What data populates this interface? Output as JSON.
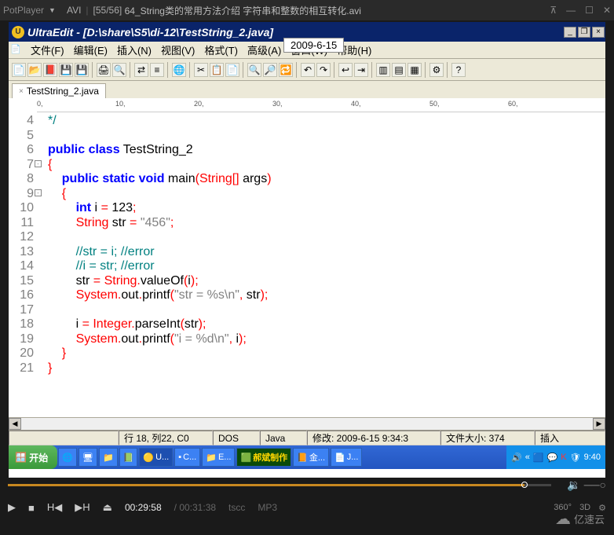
{
  "player": {
    "app_name": "PotPlayer",
    "format": "AVI",
    "counter": "[55/56]",
    "filename": "64_String类的常用方法介绍 字符串和整数的相互转化.avi",
    "time_current": "00:29:58",
    "time_total": "00:31:38",
    "codec_v": "tscc",
    "codec_a": "MP3",
    "opt_360": "360°",
    "opt_3d": "3D",
    "date_overlay": "2009-6-15"
  },
  "ultraedit": {
    "title": "UltraEdit - [D:\\share\\S5\\di-12\\TestString_2.java]",
    "menus": {
      "file": "文件(F)",
      "edit": "编辑(E)",
      "insert": "插入(N)",
      "view": "视图(V)",
      "format": "格式(T)",
      "adv": "高级(A)",
      "window": "窗口(W)",
      "help": "帮助(H)"
    },
    "tab_name": "TestString_2.java",
    "ruler_marks": [
      "0",
      "10",
      "20",
      "30",
      "40",
      "50",
      "60"
    ],
    "code_lines": [
      {
        "n": 4,
        "html": "<span class='cmt'>*/</span>"
      },
      {
        "n": 5,
        "html": ""
      },
      {
        "n": 6,
        "html": "<span class='kw kw-blue'>public</span> <span class='kw kw-blue'>class</span> <span class='cls'>TestString_2</span>"
      },
      {
        "n": 7,
        "fold": true,
        "html": "<span class='pun'>{</span>"
      },
      {
        "n": 8,
        "html": "    <span class='kw kw-blue'>public</span> <span class='kw kw-blue'>static</span> <span class='kw kw-blue'>void</span> main<span class='pun'>(</span><span class='kw-red'>String</span><span class='pun'>[]</span> args<span class='pun'>)</span>"
      },
      {
        "n": 9,
        "fold": true,
        "html": "    <span class='pun'>{</span>"
      },
      {
        "n": 10,
        "html": "        <span class='kw kw-blue'>int</span> i <span class='pun'>=</span> 123<span class='pun'>;</span>"
      },
      {
        "n": 11,
        "html": "        <span class='kw-red'>String</span> str <span class='pun'>=</span> <span class='str'>\"456\"</span><span class='pun'>;</span>"
      },
      {
        "n": 12,
        "html": ""
      },
      {
        "n": 13,
        "html": "        <span class='cmt'>//str = i; //error</span>"
      },
      {
        "n": 14,
        "html": "        <span class='cmt'>//i = str; //error</span>"
      },
      {
        "n": 15,
        "html": "        str <span class='pun'>=</span> <span class='kw-red'>String</span><span class='pun'>.</span>valueOf<span class='pun'>(</span>i<span class='pun'>);</span>"
      },
      {
        "n": 16,
        "html": "        <span class='kw-red'>System</span><span class='pun'>.</span>out<span class='pun'>.</span>printf<span class='pun'>(</span><span class='str'>\"str = %s\\n\"</span><span class='pun'>,</span> str<span class='pun'>);</span>"
      },
      {
        "n": 17,
        "html": ""
      },
      {
        "n": 18,
        "html": "        i <span class='pun'>=</span> <span class='kw-red'>Integer</span><span class='pun'>.</span>parseInt<span class='pun'>(</span>str<span class='pun'>);</span>"
      },
      {
        "n": 19,
        "html": "        <span class='kw-red'>System</span><span class='pun'>.</span>out<span class='pun'>.</span>printf<span class='pun'>(</span><span class='str'>\"i = %d\\n\"</span><span class='pun'>,</span> i<span class='pun'>);</span>"
      },
      {
        "n": 20,
        "html": "    <span class='pun'>}</span>"
      },
      {
        "n": 21,
        "html": "<span class='pun'>}</span>"
      }
    ],
    "status": {
      "pos": "行 18, 列22, C0",
      "enc": "DOS",
      "lang": "Java",
      "mod": "修改: 2009-6-15 9:34:3",
      "size": "文件大小: 374",
      "ins": "插入"
    }
  },
  "taskbar": {
    "start": "开始",
    "items": [
      {
        "icon": "🟡",
        "label": "U..."
      },
      {
        "icon": "▪",
        "label": "C..."
      },
      {
        "icon": "📁",
        "label": "E..."
      },
      {
        "icon": "🟩",
        "label": "郝斌制作",
        "green": true
      },
      {
        "icon": "📙",
        "label": "金..."
      },
      {
        "icon": "📄",
        "label": "J..."
      }
    ],
    "tray_time": "9:40"
  },
  "watermark": "亿速云"
}
